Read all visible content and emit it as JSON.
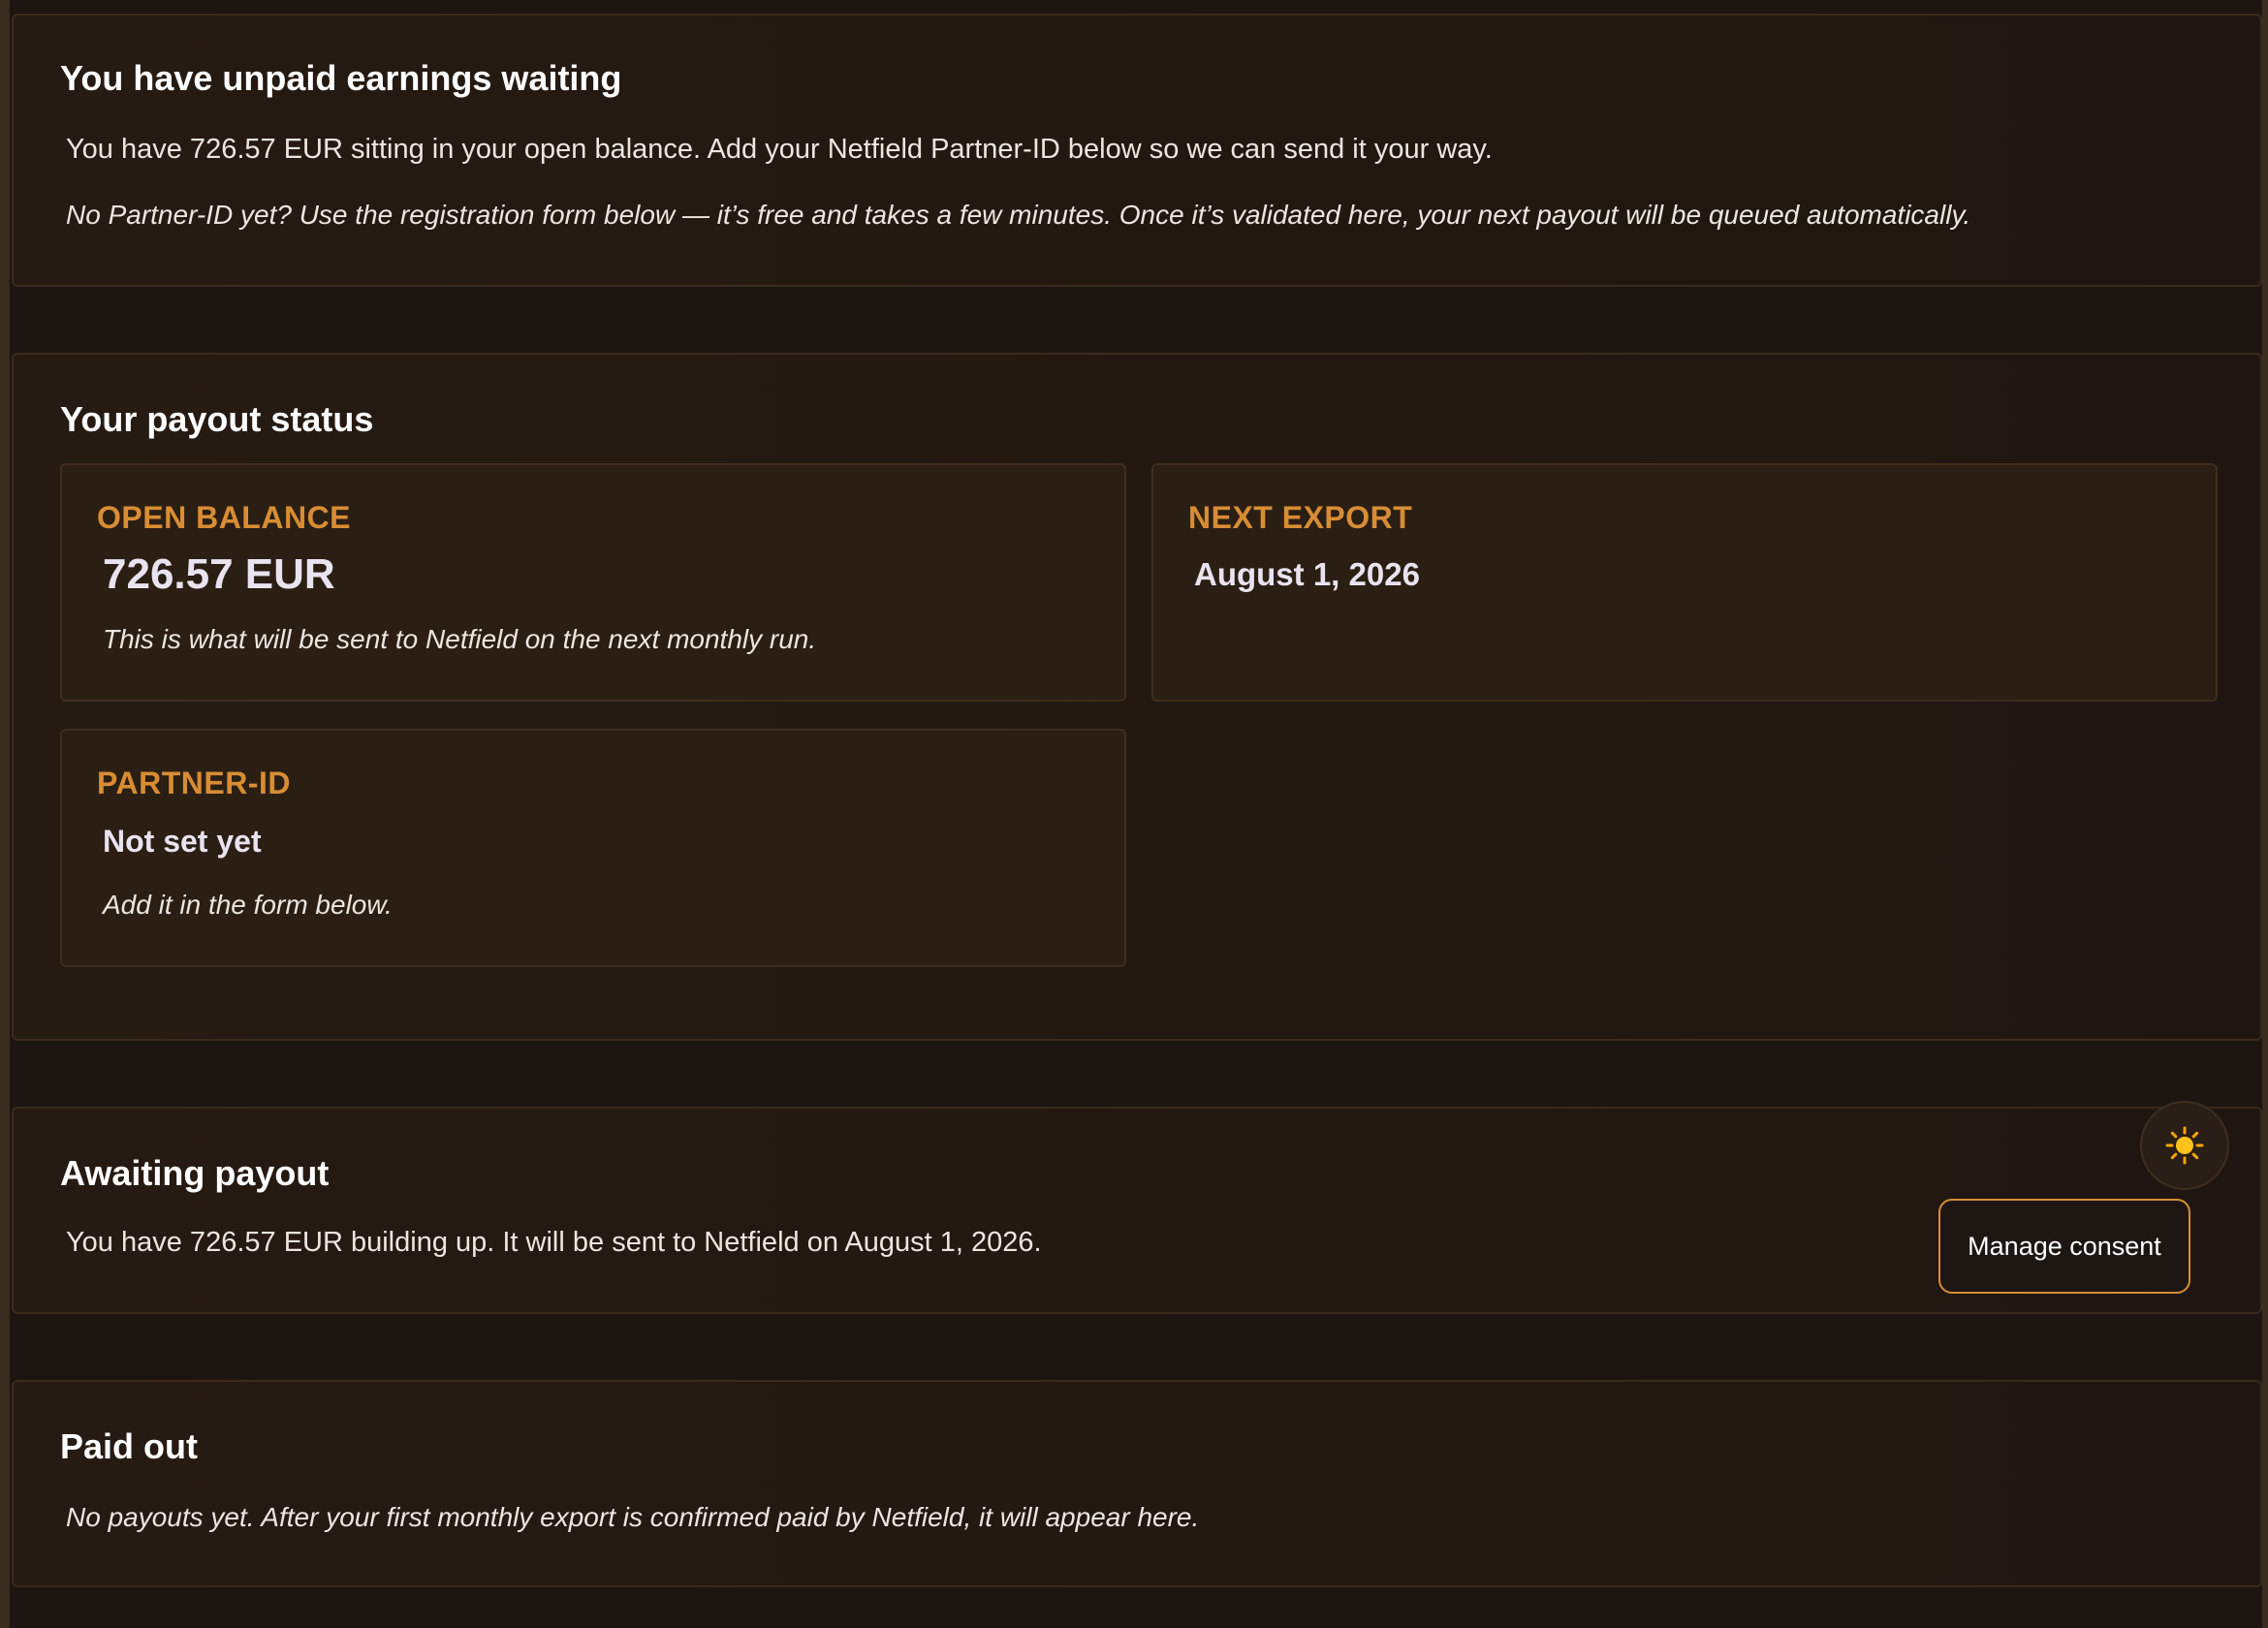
{
  "unpaid": {
    "title": "You have unpaid earnings waiting",
    "message": "You have 726.57 EUR sitting in your open balance. Add your Netfield Partner-ID below so we can send it your way.",
    "hint": "No Partner-ID yet? Use the registration form below — it’s free and takes a few minutes. Once it’s validated here, your next payout will be queued automatically."
  },
  "status": {
    "title": "Your payout status",
    "open_balance": {
      "label": "OPEN BALANCE",
      "value": "726.57 EUR",
      "note": "This is what will be sent to Netfield on the next monthly run."
    },
    "next_export": {
      "label": "NEXT EXPORT",
      "value": "August 1, 2026"
    },
    "partner_id": {
      "label": "PARTNER-ID",
      "value": "Not set yet",
      "note": "Add it in the form below."
    }
  },
  "awaiting": {
    "title": "Awaiting payout",
    "message": "You have 726.57 EUR building up. It will be sent to Netfield on August 1, 2026."
  },
  "paid_out": {
    "title": "Paid out",
    "message": "No payouts yet. After your first monthly export is confirmed paid by Netfield, it will appear here."
  },
  "controls": {
    "theme_toggle_icon": "sun-icon",
    "manage_consent_label": "Manage consent"
  },
  "colors": {
    "accent": "#d88d34",
    "background": "#1d1512",
    "card": "#241a12"
  }
}
